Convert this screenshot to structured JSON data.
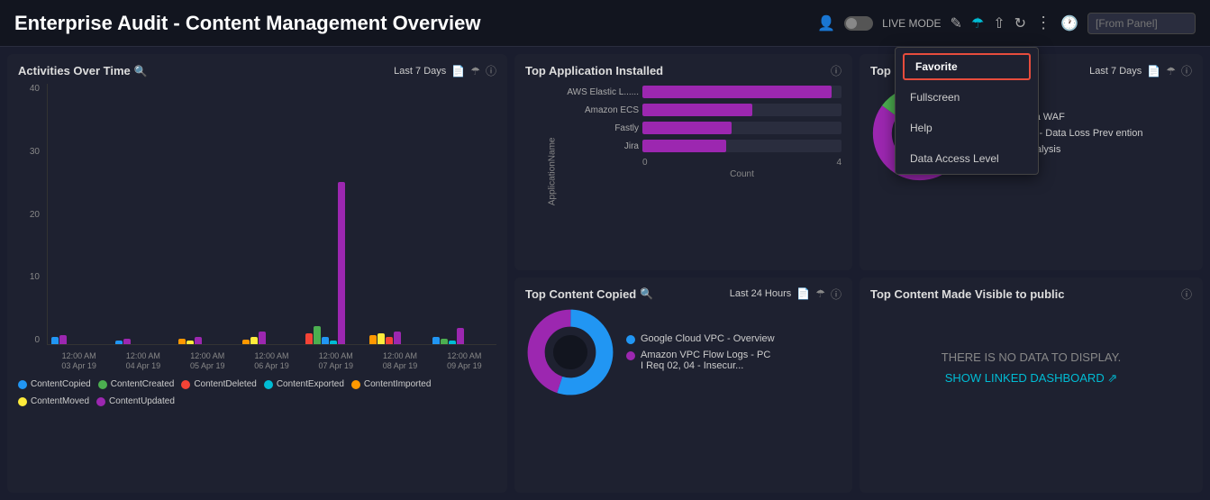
{
  "header": {
    "title": "Enterprise Audit - Content Management Overview",
    "live_mode_label": "LIVE MODE",
    "search_placeholder": "[From Panel]"
  },
  "dropdown": {
    "items": [
      "Favorite",
      "Fullscreen",
      "Help",
      "Data Access Level"
    ]
  },
  "activities_panel": {
    "title": "Activities Over Time",
    "time_range": "Last 7 Days",
    "y_labels": [
      "40",
      "30",
      "20",
      "10",
      "0"
    ],
    "x_labels": [
      {
        "line1": "12:00 AM",
        "line2": "03 Apr 19"
      },
      {
        "line1": "12:00 AM",
        "line2": "04 Apr 19"
      },
      {
        "line1": "12:00 AM",
        "line2": "05 Apr 19"
      },
      {
        "line1": "12:00 AM",
        "line2": "06 Apr 19"
      },
      {
        "line1": "12:00 AM",
        "line2": "07 Apr 19"
      },
      {
        "line1": "12:00 AM",
        "line2": "08 Apr 19"
      },
      {
        "line1": "12:00 AM",
        "line2": "09 Apr 19"
      }
    ],
    "legend": [
      {
        "label": "ContentCopied",
        "color": "#2196f3"
      },
      {
        "label": "ContentCreated",
        "color": "#4caf50"
      },
      {
        "label": "ContentDeleted",
        "color": "#f44336"
      },
      {
        "label": "ContentExported",
        "color": "#00bcd4"
      },
      {
        "label": "ContentImported",
        "color": "#ff9800"
      },
      {
        "label": "ContentMoved",
        "color": "#ffeb3b"
      },
      {
        "label": "ContentUpdated",
        "color": "#9c27b0"
      }
    ]
  },
  "top_app_panel": {
    "title": "Top Application Installed",
    "axis_label": "ApplicationName",
    "count_label": "Count",
    "bars": [
      {
        "label": "AWS Elastic L......",
        "width_pct": 95
      },
      {
        "label": "Amazon ECS",
        "width_pct": 55
      },
      {
        "label": "Fastly",
        "width_pct": 45
      },
      {
        "label": "Jira",
        "width_pct": 42
      }
    ],
    "x_ticks": [
      "0",
      "4"
    ]
  },
  "top_c_panel": {
    "title": "Top C...",
    "time_range": "Last 7 Days",
    "legend": [
      {
        "label": "Barracuda WAF",
        "color": "#4dd"
      },
      {
        "label": "Netskope - Data Loss Prevention",
        "color": "#9c27b0"
      },
      {
        "label": "Traffic Analysis",
        "color": "#4caf50"
      }
    ],
    "donut": {
      "segments": [
        {
          "color": "#4dd",
          "pct": 15
        },
        {
          "color": "#9c27b0",
          "pct": 70
        },
        {
          "color": "#4caf50",
          "pct": 15
        }
      ]
    }
  },
  "top_copied_panel": {
    "title": "Top Content Copied",
    "time_range": "Last 24 Hours",
    "legend": [
      {
        "label": "Google Cloud VPC - Overview",
        "color": "#2196f3"
      },
      {
        "label": "Amazon VPC Flow Logs - PC I Req 02, 04 - Insecur...",
        "color": "#9c27b0"
      }
    ]
  },
  "top_visible_panel": {
    "title": "Top Content Made Visible to public",
    "no_data_line1": "THERE IS NO DATA TO DISPLAY.",
    "no_data_line2": "SHOW LINKED DASHBOARD"
  }
}
